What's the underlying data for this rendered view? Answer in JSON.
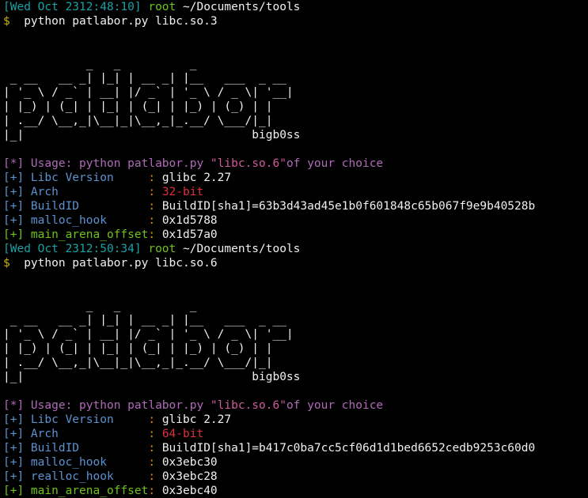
{
  "session1": {
    "prompt": {
      "time": "[Wed Oct 2312:48:10]",
      "user": "root",
      "path": "~/Documents/tools"
    },
    "command": {
      "sign": "$",
      "text": "  python patlabor.py libc.so.3"
    },
    "banner": [
      "            _   _          _",
      " _ __   __ _| |_| | __ _| |__   ___  _ __",
      "| '_ \\ / _` | __| |/ _` | '_ \\ / _ \\| '__|",
      "| |_) | (_| | |_| | (_| | |_) | (_) | |",
      "| .__/ \\__,_|\\__|_|\\__,_|_.__/ \\___/|_|",
      "|_|                                 bigb0ss"
    ],
    "usage": {
      "tag": "[*]",
      "text": " Usage: python patlabor.py ",
      "arg": "\"libc.so.6\"",
      "tail": "of your choice"
    },
    "fields": [
      {
        "tag": "[+]",
        "label": " Libc Version     ",
        "colon": ": ",
        "value": "glibc 2.27",
        "color": "white"
      },
      {
        "tag": "[+]",
        "label": " Arch             ",
        "colon": ": ",
        "value": "32-bit",
        "color": "red"
      },
      {
        "tag": "[+]",
        "label": " BuildID          ",
        "colon": ": ",
        "value": "BuildID[sha1]=63b3d43ad45e1b0f601848c65b067f9e9b40528b",
        "color": "white"
      },
      {
        "tag": "[+]",
        "label": " malloc_hook      ",
        "colon": ": ",
        "value": "0x1d5788",
        "color": "white"
      }
    ],
    "arena": {
      "tag": "[+]",
      "label": " main_arena_offset",
      "colon": ": ",
      "value": "0x1d57a0"
    }
  },
  "session2": {
    "prompt": {
      "time": "[Wed Oct 2312:50:34]",
      "user": "root",
      "path": "~/Documents/tools"
    },
    "command": {
      "sign": "$",
      "text": "  python patlabor.py libc.so.6"
    },
    "banner": [
      "            _   _          _",
      " _ __   __ _| |_| | __ _| |__   ___  _ __",
      "| '_ \\ / _` | __| |/ _` | '_ \\ / _ \\| '__|",
      "| |_) | (_| | |_| | (_| | |_) | (_) | |",
      "| .__/ \\__,_|\\__|_|\\__,_|_.__/ \\___/|_|",
      "|_|                                 bigb0ss"
    ],
    "usage": {
      "tag": "[*]",
      "text": " Usage: python patlabor.py ",
      "arg": "\"libc.so.6\"",
      "tail": "of your choice"
    },
    "fields": [
      {
        "tag": "[+]",
        "label": " Libc Version     ",
        "colon": ": ",
        "value": "glibc 2.27",
        "color": "white"
      },
      {
        "tag": "[+]",
        "label": " Arch             ",
        "colon": ": ",
        "value": "64-bit",
        "color": "red"
      },
      {
        "tag": "[+]",
        "label": " BuildID          ",
        "colon": ": ",
        "value": "BuildID[sha1]=b417c0ba7cc5cf06d1d1bed6652cedb9253c60d0",
        "color": "white"
      },
      {
        "tag": "[+]",
        "label": " malloc_hook      ",
        "colon": ": ",
        "value": "0x3ebc30",
        "color": "white"
      },
      {
        "tag": "[+]",
        "label": " realloc_hook     ",
        "colon": ": ",
        "value": "0x3ebc28",
        "color": "white"
      }
    ],
    "arena": {
      "tag": "[+]",
      "label": " main_arena_offset",
      "colon": ": ",
      "value": "0x3ebc40"
    }
  }
}
